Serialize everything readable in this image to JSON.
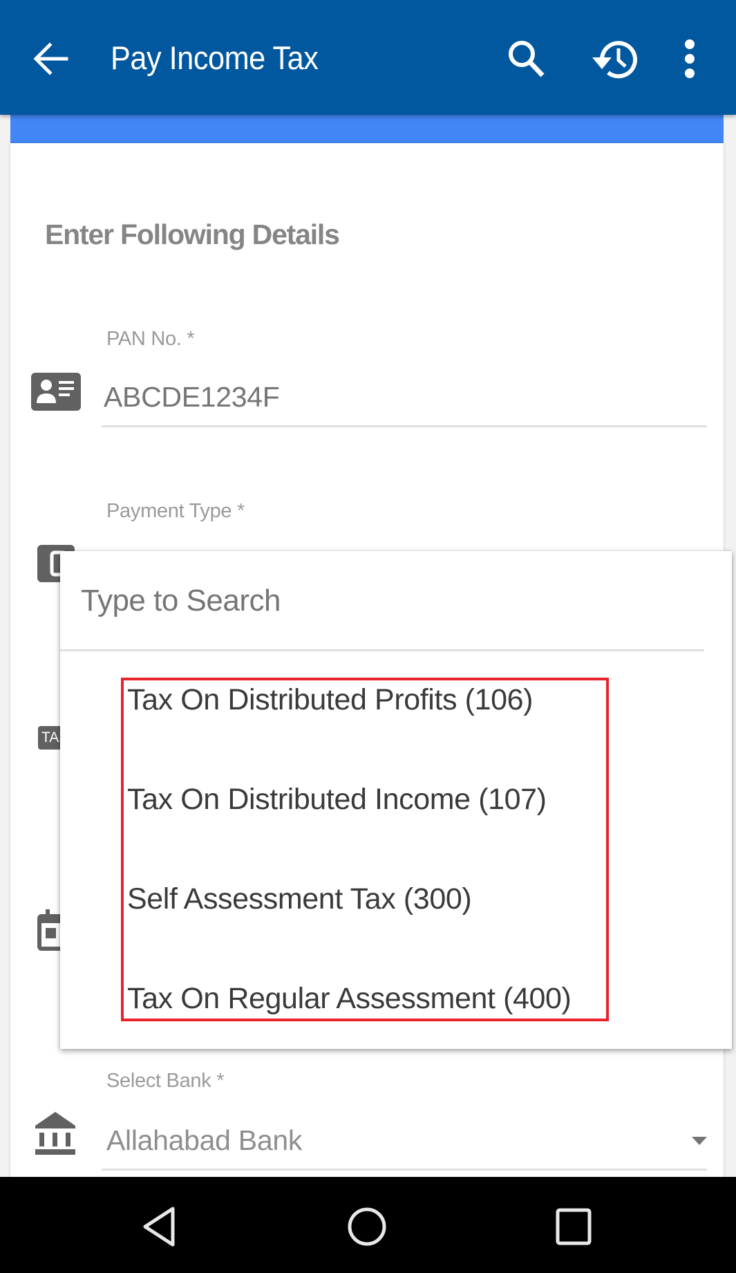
{
  "appbar": {
    "title": "Pay Income Tax",
    "back_icon": "arrow-back-icon",
    "actions": [
      {
        "name": "search",
        "icon": "search-icon"
      },
      {
        "name": "history",
        "icon": "history-icon"
      },
      {
        "name": "more",
        "icon": "more-vert-icon"
      }
    ]
  },
  "colors": {
    "appbar": "#02589e",
    "accent_strip": "#4285f4",
    "highlight_border": "#e8232b"
  },
  "form": {
    "heading": "Enter Following Details",
    "pan": {
      "label": "PAN No. *",
      "placeholder": "ABCDE1234F",
      "icon": "id-card-icon"
    },
    "payment_type": {
      "label": "Payment Type *",
      "icon": "payment-type-icon"
    },
    "tax_icon_text": "TAX",
    "date_icon": "calendar-icon",
    "bank": {
      "label": "Select Bank *",
      "value": "Allahabad Bank",
      "icon": "bank-icon"
    }
  },
  "dropdown": {
    "search_placeholder": "Type to Search",
    "options": [
      "Tax On Distributed Profits (106)",
      "Tax On Distributed Income (107)",
      "Self Assessment Tax (300)",
      "Tax On Regular Assessment (400)"
    ]
  },
  "navbar": {
    "buttons": [
      "back",
      "home",
      "recents"
    ]
  }
}
